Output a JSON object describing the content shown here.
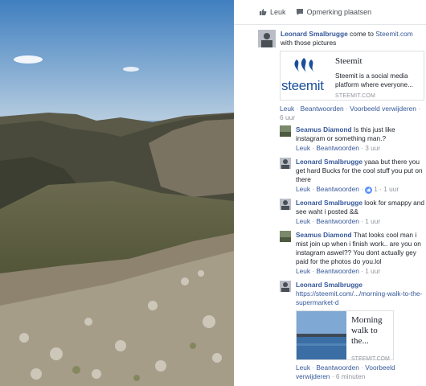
{
  "actions": {
    "like_label": "Leuk",
    "comment_label": "Opmerking plaatsen"
  },
  "post": {
    "author": "Leonard Smalbrugge",
    "text_before_link": " come to ",
    "link": "Steemit.com",
    "text_after_link": " with those pictures",
    "preview": {
      "title": "Steemit",
      "description": "Steemit is a social media platform where everyone...",
      "domain": "STEEMIT.COM",
      "logo_text": "steemit"
    },
    "meta": {
      "like": "Leuk",
      "reply": "Beantwoorden",
      "delete_preview": "Voorbeeld verwijderen",
      "time": "6 uur"
    }
  },
  "comments": [
    {
      "author": "Seamus Diamond",
      "text": " Is this just like instagram or something man.?",
      "like": "Leuk",
      "reply": "Beantwoorden",
      "time": "3 uur"
    },
    {
      "author": "Leonard Smalbrugge",
      "text": " yaaa but there you get hard Bucks for the cool stuff you put on there",
      "like": "Leuk",
      "reply": "Beantwoorden",
      "reactions": "1",
      "time": "1 uur"
    },
    {
      "author": "Leonard Smalbrugge",
      "text": " look for smappy and see waht i posted &&",
      "like": "Leuk",
      "reply": "Beantwoorden",
      "time": "1 uur"
    },
    {
      "author": "Seamus Diamond",
      "text": " That looks cool man i mist join up when i finish work.. are you on instagram aswel?? You dont actually gey paid for the photos do you.lol",
      "like": "Leuk",
      "reply": "Beantwoorden",
      "time": "1 uur"
    },
    {
      "author": "Leonard Smalbrugge",
      "link": "https://steemit.com/.../morning-walk-to-the-supermarket-d",
      "preview": {
        "title": "Morning walk to the...",
        "domain": "STEEMIT.COM"
      },
      "like": "Leuk",
      "reply": "Beantwoorden",
      "delete_preview": "Voorbeeld verwijderen",
      "time": "6 minuten"
    }
  ],
  "colors": {
    "link": "#365899",
    "muted": "#90949c",
    "like_blue": "#5890ff",
    "steemit_blue": "#1a5099"
  }
}
